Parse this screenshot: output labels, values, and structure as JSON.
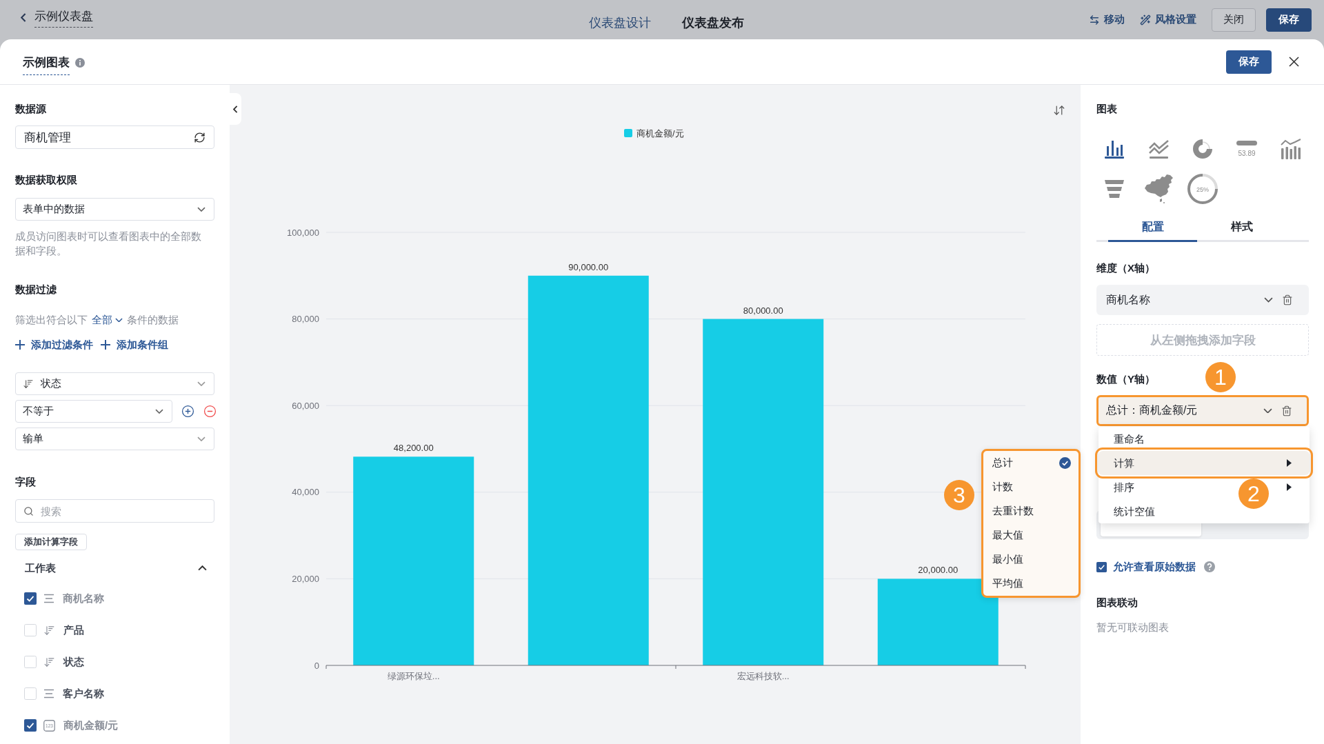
{
  "top_bar": {
    "back_label": "示例仪表盘",
    "tabs": [
      {
        "label": "仪表盘设计",
        "selected": true
      },
      {
        "label": "仪表盘发布",
        "selected": false
      }
    ],
    "actions": [
      {
        "kind": "move",
        "label": "移动"
      },
      {
        "kind": "style",
        "label": "风格设置"
      }
    ],
    "buttons": [
      {
        "kind": "secondary",
        "label": "关闭"
      },
      {
        "kind": "primary",
        "label": "保存"
      }
    ]
  },
  "dialog": {
    "title": "示例图表",
    "save_label": "保存"
  },
  "left_panel": {
    "data_source": {
      "heading": "数据源",
      "value": "商机管理"
    },
    "permission": {
      "heading": "数据获取权限",
      "value": "表单中的数据",
      "hint": "成员访问图表时可以查看图表中的全部数据和字段。"
    },
    "filter": {
      "heading": "数据过滤",
      "text_before": "筛选出符合以下",
      "match": "全部",
      "text_after": "条件的数据",
      "add_actions": [
        "添加过滤条件",
        "添加条件组"
      ],
      "condition": {
        "field": "状态",
        "operator": "不等于",
        "value": "输单"
      }
    },
    "fields": {
      "heading": "字段",
      "search_placeholder": "搜索",
      "add_button": "添加计算字段",
      "group": {
        "label": "工作表",
        "expanded": true
      },
      "items": [
        {
          "label": "商机名称",
          "kind": "text",
          "checked": true
        },
        {
          "label": "产品",
          "kind": "option",
          "checked": false
        },
        {
          "label": "状态",
          "kind": "option",
          "checked": false
        },
        {
          "label": "客户名称",
          "kind": "text",
          "checked": false
        },
        {
          "label": "商机金额/元",
          "kind": "number",
          "icon_text": "123",
          "checked": true
        }
      ]
    }
  },
  "chart": {
    "chart_data": {
      "type": "bar",
      "grid": true,
      "categories": [
        "绿源环保垃...",
        null,
        "宏远科技软...",
        null
      ],
      "series": [
        {
          "name": "商机金额/元",
          "color": "#16cde6",
          "values": [
            48200,
            90000,
            80000,
            20000
          ]
        }
      ],
      "ylim": [
        0,
        100000
      ],
      "yticks": [
        {
          "value": 0,
          "label": "0"
        },
        {
          "value": 20000,
          "label": "20,000"
        },
        {
          "value": 40000,
          "label": "40,000"
        },
        {
          "value": 60000,
          "label": "60,000"
        },
        {
          "value": 80000,
          "label": "80,000"
        },
        {
          "value": 100000,
          "label": "100,000"
        }
      ],
      "value_labels": [
        "48,200.00",
        "90,000.00",
        "80,000.00",
        "20,000.00"
      ]
    }
  },
  "calculation_menu": {
    "badge": "3",
    "highlighted": true,
    "items": [
      {
        "label": "总计",
        "selected": true
      },
      {
        "label": "计数",
        "selected": false
      },
      {
        "label": "去重计数",
        "selected": false
      },
      {
        "label": "最大值",
        "selected": false
      },
      {
        "label": "最小值",
        "selected": false
      },
      {
        "label": "平均值",
        "selected": false
      }
    ]
  },
  "right_panel": {
    "heading": "图表",
    "chart_types": [
      {
        "kind": "bar",
        "selected": true
      },
      {
        "kind": "line",
        "selected": false
      },
      {
        "kind": "donut",
        "selected": false
      },
      {
        "kind": "indicator",
        "caption": "53.89",
        "selected": false
      },
      {
        "kind": "combo",
        "selected": false
      },
      {
        "kind": "funnel",
        "selected": false
      },
      {
        "kind": "map",
        "selected": false
      },
      {
        "kind": "progress",
        "caption": "25%",
        "selected": false
      }
    ],
    "tabs": [
      {
        "label": "配置",
        "selected": true
      },
      {
        "label": "样式",
        "selected": false
      }
    ],
    "dimension": {
      "heading": "维度（X轴）",
      "field": "商机名称",
      "drop_hint": "从左侧拖拽添加字段"
    },
    "measure": {
      "heading": "数值（Y轴）",
      "badge": "1",
      "field": "总计：商机金额/元",
      "highlighted": true
    },
    "field_menu": {
      "badge": "2",
      "items": [
        {
          "label": "重命名",
          "submenu": false,
          "highlighted": false
        },
        {
          "label": "计算",
          "submenu": true,
          "highlighted": true
        },
        {
          "label": "排序",
          "submenu": true,
          "highlighted": false
        },
        {
          "label": "统计空值",
          "submenu": false,
          "highlighted": false
        }
      ]
    },
    "orientation": {
      "segments": [
        {
          "selected": true
        },
        {
          "selected": false
        }
      ]
    },
    "raw_data": {
      "label": "允许查看原始数据",
      "checked": true
    },
    "linkage": {
      "heading": "图表联动",
      "empty_text": "暂无可联动图表"
    }
  }
}
